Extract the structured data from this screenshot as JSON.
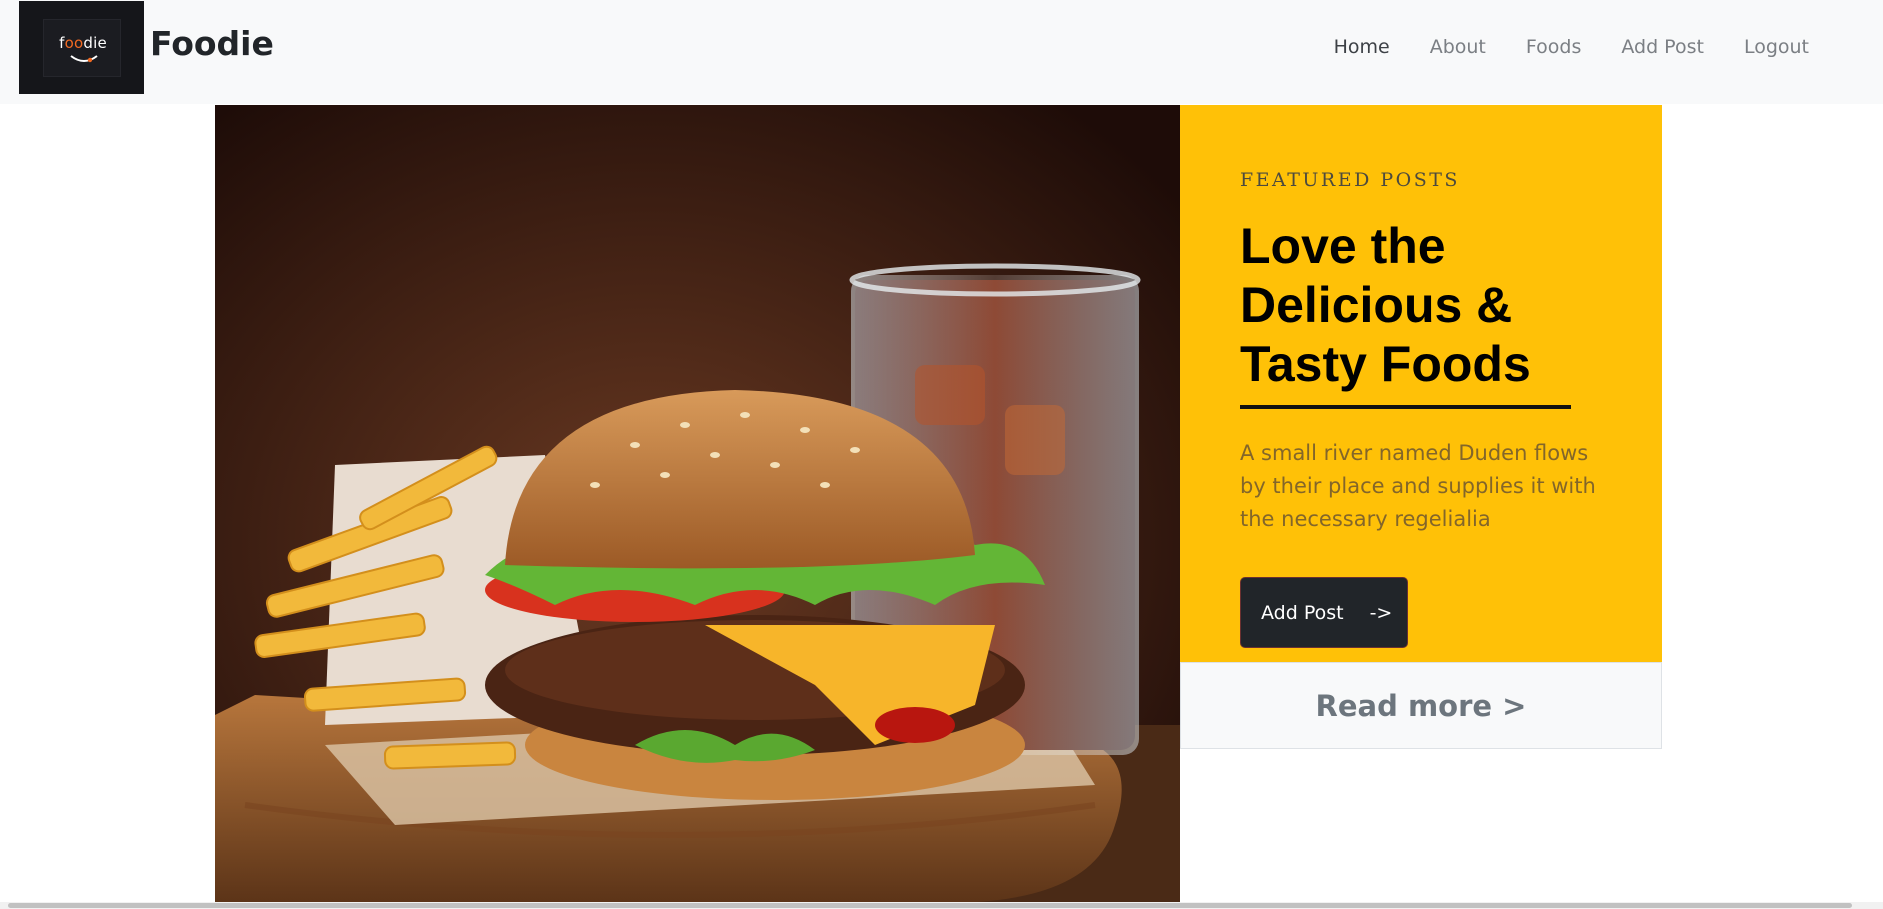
{
  "navbar": {
    "logo_text": "foodie",
    "brand": "Foodie",
    "links": [
      "Home",
      "About",
      "Foods",
      "Add Post",
      "Logout"
    ],
    "active": "Home"
  },
  "hero": {
    "image_alt": "Burger with fries and cola on a wooden board",
    "eyebrow": "FEATURED POSTS",
    "headline": "Love the Delicious & Tasty Foods",
    "blurb": "A small river named Duden flows by their place and supplies it with the necessary regelialia",
    "button_label": "Add Post",
    "button_arrow": "->",
    "read_more": "Read more >"
  },
  "colors": {
    "accent": "#ffc107",
    "dark": "#212529",
    "logo_orange": "#f26a22"
  }
}
